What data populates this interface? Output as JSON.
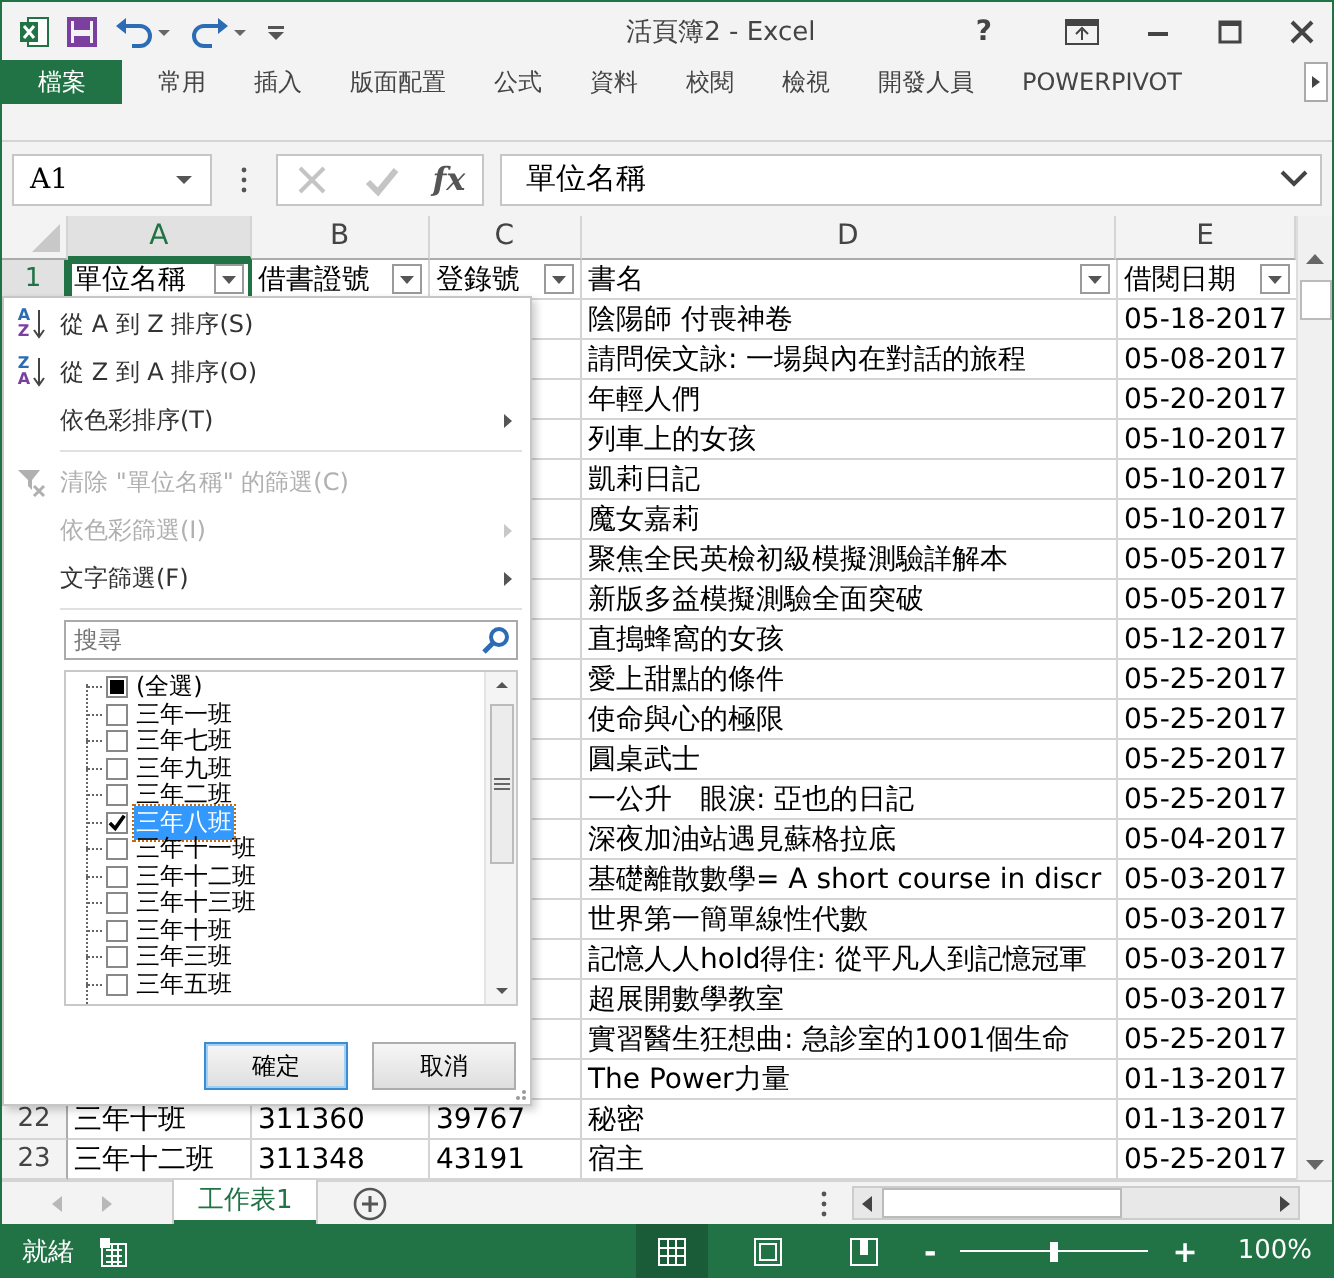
{
  "window": {
    "title": "活頁簿2 - Excel",
    "help": "?"
  },
  "ribbon_tabs": [
    {
      "label": "檔案",
      "kind": "file"
    },
    {
      "label": "常用",
      "kind": "tab"
    },
    {
      "label": "插入",
      "kind": "tab"
    },
    {
      "label": "版面配置",
      "kind": "tab"
    },
    {
      "label": "公式",
      "kind": "tab"
    },
    {
      "label": "資料",
      "kind": "tab"
    },
    {
      "label": "校閱",
      "kind": "tab"
    },
    {
      "label": "檢視",
      "kind": "tab"
    },
    {
      "label": "開發人員",
      "kind": "tab"
    },
    {
      "label": "POWERPIVOT",
      "kind": "tab"
    }
  ],
  "formula_bar": {
    "name_box": "A1",
    "fx": "fx",
    "value": "單位名稱"
  },
  "columns": [
    {
      "label": "A",
      "selected": true
    },
    {
      "label": "B",
      "selected": false
    },
    {
      "label": "C",
      "selected": false
    },
    {
      "label": "D",
      "selected": false
    },
    {
      "label": "E",
      "selected": false
    }
  ],
  "header_row": {
    "number": "1",
    "selected": true,
    "cells": [
      {
        "text": "單位名稱",
        "active": true
      },
      {
        "text": "借書證號",
        "active": false
      },
      {
        "text": "登錄號",
        "active": false
      },
      {
        "text": "書名",
        "active": false
      },
      {
        "text": "借閱日期",
        "active": false
      }
    ]
  },
  "rows": [
    {
      "cells": {
        "d": "陰陽師 付喪神卷",
        "e": "05-18-2017"
      }
    },
    {
      "cells": {
        "d": "請問侯文詠: 一場與內在對話的旅程",
        "e": "05-08-2017"
      }
    },
    {
      "cells": {
        "d": "年輕人們",
        "e": "05-20-2017"
      }
    },
    {
      "cells": {
        "d": "列車上的女孩",
        "e": "05-10-2017"
      }
    },
    {
      "cells": {
        "d": "凱莉日記",
        "e": "05-10-2017"
      }
    },
    {
      "cells": {
        "d": "魔女嘉莉",
        "e": "05-10-2017"
      }
    },
    {
      "cells": {
        "d": "聚焦全民英檢初級模擬測驗詳解本",
        "e": "05-05-2017"
      }
    },
    {
      "cells": {
        "d": "新版多益模擬測驗全面突破",
        "e": "05-05-2017"
      }
    },
    {
      "cells": {
        "d": "直搗蜂窩的女孩",
        "e": "05-12-2017"
      }
    },
    {
      "cells": {
        "d": "愛上甜點的條件",
        "e": "05-25-2017"
      }
    },
    {
      "cells": {
        "d": "使命與心的極限",
        "e": "05-25-2017"
      }
    },
    {
      "cells": {
        "d": "圓桌武士",
        "e": "05-25-2017"
      }
    },
    {
      "cells": {
        "d": "一公升　眼淚: 亞也的日記",
        "e": "05-25-2017"
      }
    },
    {
      "cells": {
        "d": "深夜加油站遇見蘇格拉底",
        "e": "05-04-2017"
      }
    },
    {
      "cells": {
        "d": "基礎離散數學= A short course in discr",
        "e": "05-03-2017"
      }
    },
    {
      "cells": {
        "d": "世界第一簡單線性代數",
        "e": "05-03-2017"
      }
    },
    {
      "cells": {
        "d": "記憶人人hold得住: 從平凡人到記憶冠軍",
        "e": "05-03-2017"
      }
    },
    {
      "cells": {
        "d": "超展開數學教室",
        "e": "05-03-2017"
      }
    },
    {
      "cells": {
        "d": "實習醫生狂想曲: 急診室的1001個生命",
        "e": "05-25-2017"
      }
    },
    {
      "cells": {
        "d": "The Power力量",
        "e": "01-13-2017"
      }
    },
    {
      "number": "22",
      "cells": {
        "a": "三年十班",
        "b": "311360",
        "c": "39767",
        "d": "秘密",
        "e": "01-13-2017"
      }
    },
    {
      "number": "23",
      "cells": {
        "a": "三年十二班",
        "b": "311348",
        "c": "43191",
        "d": "宿主",
        "e": "05-25-2017"
      }
    }
  ],
  "filter_menu": {
    "items": [
      {
        "kind": "sort",
        "label": "從 A 到 Z 排序(S)",
        "icon_top": "A",
        "icon_bottom": "Z",
        "disabled": false,
        "submenu": false
      },
      {
        "kind": "sort",
        "label": "從 Z 到 A 排序(O)",
        "icon_top": "Z",
        "icon_bottom": "A",
        "disabled": false,
        "submenu": false
      },
      {
        "kind": "plain",
        "label": "依色彩排序(T)",
        "disabled": false,
        "submenu": true
      },
      {
        "kind": "separator"
      },
      {
        "kind": "clear",
        "label": "清除 \"單位名稱\" 的篩選(C)",
        "disabled": true,
        "submenu": false
      },
      {
        "kind": "plain",
        "label": "依色彩篩選(I)",
        "disabled": true,
        "submenu": true
      },
      {
        "kind": "plain",
        "label": "文字篩選(F)",
        "disabled": false,
        "submenu": true
      },
      {
        "kind": "separator"
      }
    ],
    "search": {
      "placeholder": "搜尋"
    },
    "values": [
      {
        "label": "(全選)",
        "checked": false,
        "partial": true,
        "selected": false
      },
      {
        "label": "三年一班",
        "checked": false,
        "partial": false,
        "selected": false
      },
      {
        "label": "三年七班",
        "checked": false,
        "partial": false,
        "selected": false
      },
      {
        "label": "三年九班",
        "checked": false,
        "partial": false,
        "selected": false
      },
      {
        "label": "三年二班",
        "checked": false,
        "partial": false,
        "selected": false
      },
      {
        "label": "三年八班",
        "checked": true,
        "partial": false,
        "selected": true
      },
      {
        "label": "三年十一班",
        "checked": false,
        "partial": false,
        "selected": false
      },
      {
        "label": "三年十二班",
        "checked": false,
        "partial": false,
        "selected": false
      },
      {
        "label": "三年十三班",
        "checked": false,
        "partial": false,
        "selected": false
      },
      {
        "label": "三年十班",
        "checked": false,
        "partial": false,
        "selected": false
      },
      {
        "label": "三年三班",
        "checked": false,
        "partial": false,
        "selected": false
      },
      {
        "label": "三年五班",
        "checked": false,
        "partial": false,
        "selected": false
      }
    ],
    "buttons": [
      {
        "label": "確定",
        "default": true
      },
      {
        "label": "取消",
        "default": false
      }
    ]
  },
  "sheet_tabs": [
    {
      "label": "工作表1",
      "selected": true
    }
  ],
  "status_bar": {
    "text": "就緒",
    "view_buttons": [
      {
        "kind": "normal",
        "selected": true
      },
      {
        "kind": "page_layout",
        "selected": false
      },
      {
        "kind": "page_break",
        "selected": false
      }
    ],
    "zoom_out": "-",
    "zoom_in": "+",
    "zoom": {
      "level": 0.5
    },
    "zoom_text": "100%"
  }
}
